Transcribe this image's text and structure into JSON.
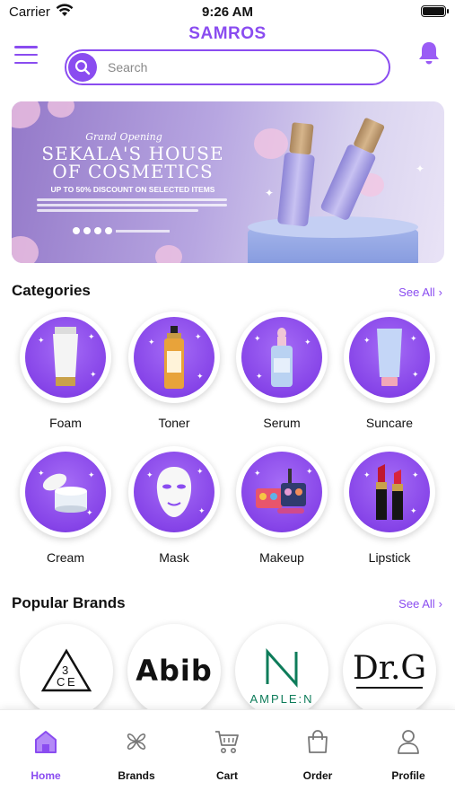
{
  "status_bar": {
    "carrier": "Carrier",
    "time": "9:26 AM",
    "battery_level": 1.0
  },
  "header": {
    "title": "SAMROS",
    "search_placeholder": "Search"
  },
  "banner": {
    "subtitle": "Grand Opening",
    "title_line1": "SEKALA'S HOUSE",
    "title_line2": "OF COSMETICS",
    "discount": "UP TO 50% DISCOUNT ON SELECTED ITEMS"
  },
  "categories": {
    "title": "Categories",
    "see_all": "See All",
    "items": [
      {
        "label": "Foam",
        "icon": "foam-tube-icon"
      },
      {
        "label": "Toner",
        "icon": "toner-bottle-icon"
      },
      {
        "label": "Serum",
        "icon": "serum-dropper-icon"
      },
      {
        "label": "Suncare",
        "icon": "suncare-tube-icon"
      },
      {
        "label": "Cream",
        "icon": "cream-jar-icon"
      },
      {
        "label": "Mask",
        "icon": "face-mask-icon"
      },
      {
        "label": "Makeup",
        "icon": "makeup-kit-icon"
      },
      {
        "label": "Lipstick",
        "icon": "lipstick-icon"
      }
    ]
  },
  "brands": {
    "title": "Popular Brands",
    "see_all": "See All",
    "items": [
      {
        "name": "3CE",
        "logo_text": "3CE"
      },
      {
        "name": "Abib",
        "logo_text": "Abib"
      },
      {
        "name": "Ample:N",
        "logo_text": "AMPLE:N"
      },
      {
        "name": "Dr.G",
        "logo_text": "Dr.G"
      }
    ]
  },
  "bottom_nav": {
    "items": [
      {
        "label": "Home",
        "icon": "home-icon",
        "active": true
      },
      {
        "label": "Brands",
        "icon": "brands-icon",
        "active": false
      },
      {
        "label": "Cart",
        "icon": "cart-icon",
        "active": false
      },
      {
        "label": "Order",
        "icon": "bag-icon",
        "active": false
      },
      {
        "label": "Profile",
        "icon": "profile-icon",
        "active": false
      }
    ]
  },
  "colors": {
    "accent": "#8a4cf0",
    "text": "#111111"
  }
}
